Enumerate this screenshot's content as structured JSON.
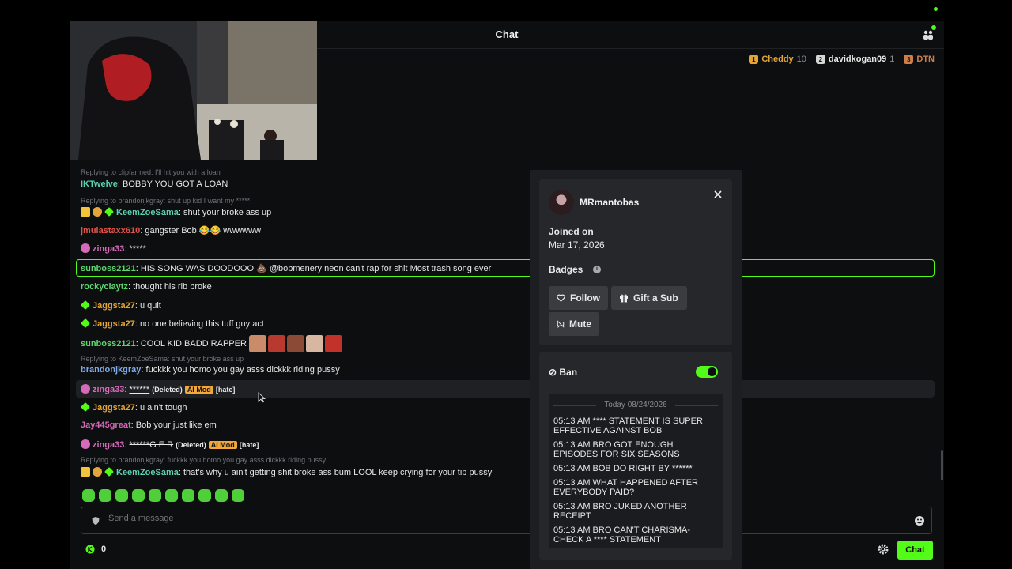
{
  "header": {
    "title": "Chat"
  },
  "leaderboard": [
    {
      "rank": "1",
      "name": "Cheddy",
      "count": "10",
      "color": "#e3a53a",
      "rank_bg": "#e3a53a"
    },
    {
      "rank": "2",
      "name": "davidkogan09",
      "count": "1",
      "color": "#e8e8e8",
      "rank_bg": "#d6d6d6"
    },
    {
      "rank": "3",
      "name": "DTN",
      "count": "",
      "color": "#cd7f4a",
      "rank_bg": "#cd7f4a"
    }
  ],
  "messages": {
    "r1_reply": "Replying to clipfarmed: I'll hit you with a loan",
    "m1_user": "IKTwelve",
    "m1_text": "BOBBY YOU GOT A LOAN",
    "r2_reply": "Replying to brandonjkgray: shut up kid I want my *****",
    "m2_user": "KeemZoeSama",
    "m2_text": "shut your broke ass up",
    "m3_user": "jmulastaxx610",
    "m3_text": "gangster Bob 😂😂 wwwwww",
    "m4_user": "zinga33",
    "m4_text": "*****",
    "m5_user": "sunboss2121",
    "m5_text": "HIS SONG WAS DOODOOO 💩 @bobmenery neon can't rap for shit Most trash song ever",
    "m6_user": "rockyclaytz",
    "m6_text": "thought his rib broke",
    "m7_user": "Jaggsta27",
    "m7_text": "u quit",
    "m8_user": "Jaggsta27",
    "m8_text": "no one believing this tuff guy act",
    "m9_user": "sunboss2121",
    "m9_text": "COOL KID BADD RAPPER",
    "r10_reply": "Replying to KeemZoeSama: shut your broke ass up",
    "m10_user": "brandonjkgray",
    "m10_text": "fuckkk you homo you gay asss dickkk riding pussy",
    "m11_user": "zinga33",
    "m11_text": "******",
    "m11_deleted": "(Deleted)",
    "m11_mod": "AI Mod",
    "m11_tag": "[hate]",
    "m12_user": "Jaggsta27",
    "m12_text": "u ain't tough",
    "m13_user": "Jay445great",
    "m13_text": "Bob your just like em",
    "m14_user": "zinga33",
    "m14_text": "******G E R",
    "m14_deleted": "(Deleted)",
    "m14_mod": "AI Mod",
    "m14_tag": "[hate]",
    "r15_reply": "Replying to brandonjkgray: fuckkk you homo you gay asss dickkk riding pussy",
    "m15_user": "KeemZoeSama",
    "m15_text": "that's why u ain't getting shit broke ass bum LOOL keep crying for your tip pussy"
  },
  "input": {
    "placeholder": "Send a message"
  },
  "footer": {
    "points": "0",
    "chat_button": "Chat"
  },
  "user_card": {
    "username": "MRmantobas",
    "joined_label": "Joined on",
    "joined_date": "Mar 17, 2026",
    "badges_label": "Badges",
    "follow": "Follow",
    "gift": "Gift a Sub",
    "mute": "Mute",
    "ban": "Ban",
    "ban_enabled": true,
    "history_date": "Today 08/24/2026",
    "history": [
      "05:13 AM **** STATEMENT IS SUPER EFFECTIVE AGAINST BOB",
      "05:13 AM BRO GOT ENOUGH EPISODES FOR SIX SEASONS",
      "05:13 AM BOB DO RIGHT BY ******",
      "05:13 AM WHAT HAPPENED AFTER EVERYBODY PAID?",
      "05:13 AM BRO JUKED ANOTHER RECEIPT",
      "05:13 AM BRO CAN'T CHARISMA-CHECK A **** STATEMENT"
    ]
  },
  "colors": {
    "accent": "#53fc18",
    "ai_mod": "#f3a83b"
  }
}
